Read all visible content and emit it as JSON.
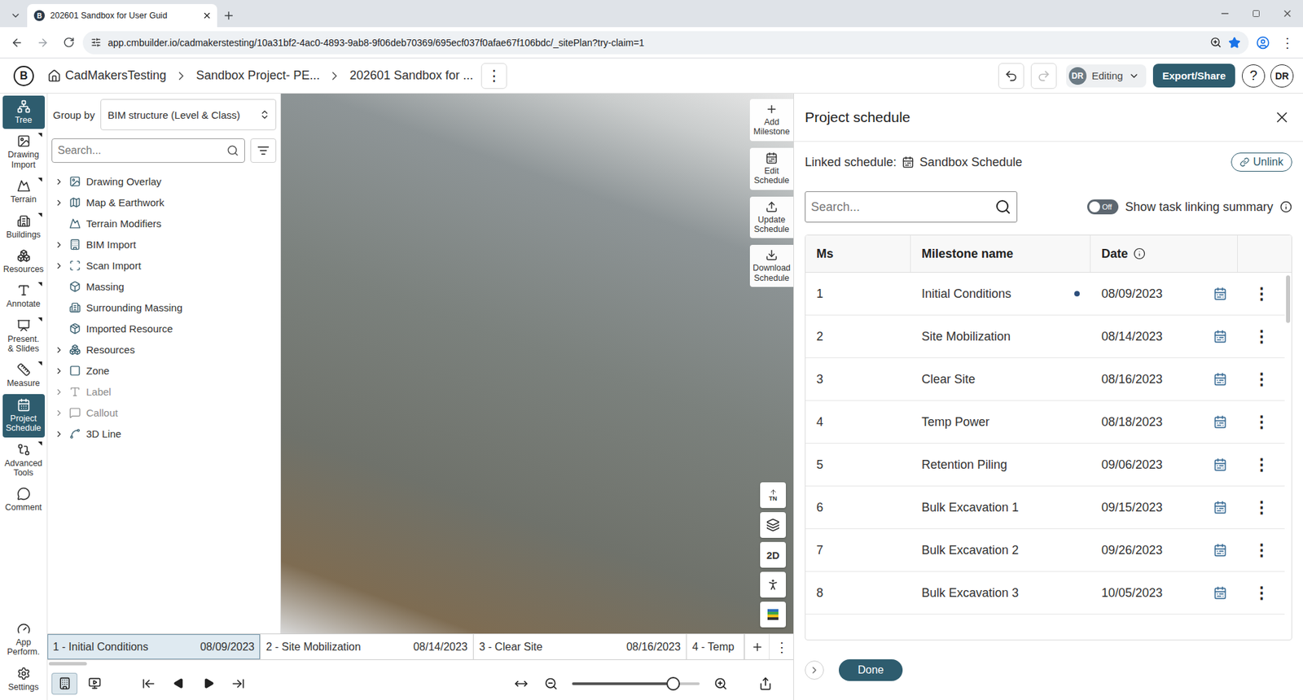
{
  "browser": {
    "tab": {
      "title": "202601 Sandbox for User Guid",
      "icon": "B",
      "selected": true
    },
    "url": "app.cmbuilder.io/cadmakerstesting/10a31bf2-4ac0-4893-9ab8-9f06deb70369/695ecf037f0afae67f106bdc/_sitePlan?try-claim=1",
    "bookmarked": true,
    "menu": "⋮"
  },
  "header": {
    "logo": "B",
    "breadcrumbs": [
      "CadMakersTesting",
      "Sandbox Project- PE...",
      "202601 Sandbox for ..."
    ],
    "more": "⋮",
    "undo_enabled": true,
    "redo_enabled": false,
    "user_badge": "DR",
    "mode": "Editing",
    "export": "Export/Share",
    "help": "?",
    "avatar": "DR"
  },
  "rail": {
    "items": [
      {
        "label": "Tree",
        "selected": true,
        "has_menu": false
      },
      {
        "label": "Drawing Import",
        "selected": false,
        "has_menu": true
      },
      {
        "label": "Terrain",
        "selected": false,
        "has_menu": true
      },
      {
        "label": "Buildings",
        "selected": false,
        "has_menu": true
      },
      {
        "label": "Resources",
        "selected": false,
        "has_menu": false
      },
      {
        "label": "Annotate",
        "selected": false,
        "has_menu": true
      },
      {
        "label": "Present. & Slides",
        "selected": false,
        "has_menu": true
      },
      {
        "label": "Measure",
        "selected": false,
        "has_menu": true
      },
      {
        "label": "Project Schedule",
        "selected": true,
        "has_menu": false
      },
      {
        "label": "Advanced Tools",
        "selected": false,
        "has_menu": true
      },
      {
        "label": "Comment",
        "selected": false,
        "has_menu": false
      },
      {
        "label": "App Perform.",
        "selected": false,
        "has_menu": false
      },
      {
        "label": "Settings",
        "selected": false,
        "has_menu": false
      }
    ]
  },
  "tree": {
    "group_by_label": "Group by",
    "group_by_value": "BIM structure (Level & Class)",
    "search_placeholder": "Search...",
    "items": [
      {
        "label": "Drawing Overlay",
        "expandable": true,
        "disabled": false
      },
      {
        "label": "Map & Earthwork",
        "expandable": true,
        "disabled": false
      },
      {
        "label": "Terrain Modifiers",
        "expandable": false,
        "disabled": false
      },
      {
        "label": "BIM Import",
        "expandable": true,
        "disabled": false
      },
      {
        "label": "Scan Import",
        "expandable": true,
        "disabled": false
      },
      {
        "label": "Massing",
        "expandable": false,
        "disabled": false
      },
      {
        "label": "Surrounding Massing",
        "expandable": false,
        "disabled": false
      },
      {
        "label": "Imported Resource",
        "expandable": false,
        "disabled": false
      },
      {
        "label": "Resources",
        "expandable": true,
        "disabled": false
      },
      {
        "label": "Zone",
        "expandable": true,
        "disabled": false
      },
      {
        "label": "Label",
        "expandable": true,
        "disabled": true
      },
      {
        "label": "Callout",
        "expandable": true,
        "disabled": true
      },
      {
        "label": "3D Line",
        "expandable": true,
        "disabled": false
      }
    ]
  },
  "viewport": {
    "tools": [
      "Add Milestone",
      "Edit Schedule",
      "Update Schedule",
      "Download Schedule"
    ],
    "view_buttons": [
      {
        "kind": "compass",
        "label": "TN"
      },
      {
        "kind": "layers"
      },
      {
        "kind": "text",
        "label": "2D"
      },
      {
        "kind": "person"
      },
      {
        "kind": "legend"
      }
    ]
  },
  "timeline": {
    "milestones": [
      {
        "label": "1 - Initial Conditions",
        "date": "08/09/2023",
        "selected": true
      },
      {
        "label": "2 - Site Mobilization",
        "date": "08/14/2023",
        "selected": false
      },
      {
        "label": "3 - Clear Site",
        "date": "08/16/2023",
        "selected": false
      },
      {
        "label": "4 - Temp",
        "selected": false
      }
    ],
    "more": "⋮",
    "view_modes": [
      {
        "kind": "site",
        "selected": true
      },
      {
        "kind": "slides",
        "selected": false
      }
    ],
    "zoom_level": 0.79
  },
  "schedule": {
    "title": "Project schedule",
    "linked_label": "Linked schedule:",
    "linked_name": "Sandbox Schedule",
    "unlink": "Unlink",
    "search_placeholder": "Search...",
    "toggle": {
      "label": "Off",
      "on": false
    },
    "toggle_caption": "Show task linking summary",
    "columns": [
      "Ms",
      "Milestone name",
      "Date"
    ],
    "row_menu": "⋮",
    "rows": [
      {
        "ms": "1",
        "name": "Initial Conditions",
        "date": "08/09/2023",
        "marker": true
      },
      {
        "ms": "2",
        "name": "Site Mobilization",
        "date": "08/14/2023",
        "marker": false
      },
      {
        "ms": "3",
        "name": "Clear Site",
        "date": "08/16/2023",
        "marker": false
      },
      {
        "ms": "4",
        "name": "Temp Power",
        "date": "08/18/2023",
        "marker": false
      },
      {
        "ms": "5",
        "name": "Retention Piling",
        "date": "09/06/2023",
        "marker": false
      },
      {
        "ms": "6",
        "name": "Bulk Excavation 1",
        "date": "09/15/2023",
        "marker": false
      },
      {
        "ms": "7",
        "name": "Bulk Excavation 2",
        "date": "09/26/2023",
        "marker": false
      },
      {
        "ms": "8",
        "name": "Bulk Excavation 3",
        "date": "10/05/2023",
        "marker": false
      }
    ],
    "done": "Done"
  }
}
